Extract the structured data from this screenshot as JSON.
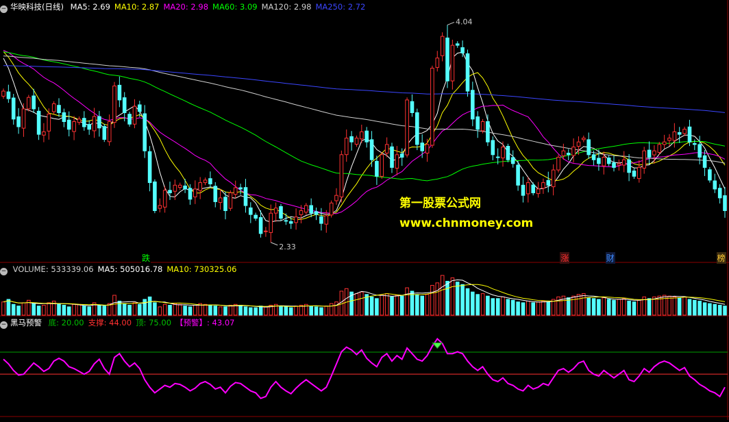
{
  "main_header": {
    "stock_name": "华映科技(日线)",
    "items": [
      {
        "text": "MA5: 2.69",
        "color": "#ffffff"
      },
      {
        "text": "MA10: 2.87",
        "color": "#ffff00"
      },
      {
        "text": "MA20: 2.98",
        "color": "#ff00ff"
      },
      {
        "text": "MA60: 3.09",
        "color": "#00ff00"
      },
      {
        "text": "MA120: 2.98",
        "color": "#d0d0d0"
      },
      {
        "text": "MA250: 2.72",
        "color": "#3b46ff"
      }
    ]
  },
  "volume_header": {
    "items": [
      {
        "text": "VOLUME: 533339.06",
        "color": "#d0d0d0"
      },
      {
        "text": "MA5: 505016.78",
        "color": "#ffffff"
      },
      {
        "text": "MA10: 730325.06",
        "color": "#ffff00"
      }
    ]
  },
  "indicator_header": {
    "name": "黑马预警",
    "items": [
      {
        "text": "底: 20.00",
        "color": "#00c000"
      },
      {
        "text": "支撑: 44.00",
        "color": "#ff3030"
      },
      {
        "text": "顶: 75.00",
        "color": "#00c000"
      },
      {
        "text": "【预警】: 43.07",
        "color": "#ff00ff"
      }
    ]
  },
  "watermark": {
    "line1": "第一股票公式网",
    "line2": "www.chnmoney.com"
  },
  "event_tags": [
    {
      "text": "跌",
      "color": "#00ff00",
      "bg": "#000000",
      "index": 28
    },
    {
      "text": "涨",
      "color": "#ff3030",
      "bg": "#3a1010",
      "index": 111
    },
    {
      "text": "财",
      "color": "#3b8cff",
      "bg": "#101a3a",
      "index": 120
    },
    {
      "text": "榜",
      "color": "#ffcc33",
      "bg": "#3a2a10",
      "index": 142
    }
  ],
  "chart_data": [
    {
      "type": "candlestick",
      "price_max_label": "4.04",
      "price_min_label": "2.33",
      "ylim": [
        2.2,
        4.15
      ],
      "colors": {
        "up": "#ff3232",
        "down": "#54ffff"
      },
      "series_names": [
        "MA5",
        "MA10",
        "MA20",
        "MA60",
        "MA120",
        "MA250"
      ],
      "close": [
        3.52,
        3.46,
        3.3,
        3.24,
        3.38,
        3.47,
        3.38,
        3.18,
        3.2,
        3.34,
        3.42,
        3.35,
        3.28,
        3.22,
        3.28,
        3.3,
        3.24,
        3.22,
        3.32,
        3.23,
        3.14,
        3.28,
        3.56,
        3.45,
        3.35,
        3.26,
        3.4,
        3.36,
        3.05,
        2.8,
        2.58,
        2.62,
        2.74,
        2.72,
        2.78,
        2.78,
        2.75,
        2.67,
        2.75,
        2.8,
        2.82,
        2.79,
        2.65,
        2.68,
        2.58,
        2.72,
        2.76,
        2.75,
        2.62,
        2.55,
        2.52,
        2.4,
        2.42,
        2.56,
        2.6,
        2.52,
        2.5,
        2.48,
        2.53,
        2.58,
        2.62,
        2.56,
        2.55,
        2.48,
        2.54,
        2.64,
        2.7,
        3.02,
        3.15,
        3.12,
        3.15,
        3.2,
        3.12,
        2.98,
        2.85,
        3.02,
        3.1,
        2.92,
        3.02,
        3.0,
        3.45,
        3.35,
        3.1,
        3.05,
        3.1,
        3.7,
        3.78,
        3.95,
        3.6,
        3.88,
        3.88,
        3.82,
        3.52,
        3.3,
        3.22,
        3.28,
        3.12,
        3.02,
        3.0,
        3.08,
        2.98,
        2.95,
        2.78,
        2.7,
        2.8,
        2.72,
        2.75,
        2.8,
        2.78,
        2.9,
        3.0,
        3.05,
        3.02,
        3.08,
        3.12,
        3.15,
        3.02,
        2.98,
        2.95,
        3.0,
        2.95,
        2.92,
        2.95,
        2.98,
        2.88,
        2.85,
        2.92,
        3.05,
        3.0,
        3.05,
        3.1,
        3.12,
        3.15,
        3.2,
        3.18,
        3.22,
        3.12,
        3.1,
        3.0,
        2.92,
        2.82,
        2.75,
        2.68,
        2.58
      ]
    },
    {
      "type": "bar",
      "title": "VOLUME",
      "values": [
        32,
        38,
        26,
        22,
        30,
        36,
        28,
        22,
        24,
        30,
        34,
        28,
        24,
        20,
        26,
        26,
        22,
        20,
        30,
        24,
        22,
        28,
        48,
        34,
        28,
        24,
        30,
        26,
        38,
        44,
        30,
        20,
        26,
        24,
        28,
        26,
        22,
        20,
        24,
        28,
        26,
        24,
        22,
        20,
        20,
        24,
        26,
        24,
        20,
        18,
        18,
        22,
        20,
        24,
        26,
        22,
        20,
        18,
        22,
        24,
        26,
        22,
        20,
        18,
        22,
        28,
        32,
        58,
        64,
        56,
        52,
        56,
        50,
        44,
        40,
        48,
        52,
        44,
        48,
        46,
        66,
        58,
        50,
        46,
        50,
        72,
        78,
        96,
        82,
        90,
        80,
        74,
        64,
        56,
        50,
        52,
        46,
        40,
        40,
        44,
        38,
        36,
        32,
        30,
        34,
        30,
        32,
        34,
        32,
        38,
        44,
        46,
        42,
        46,
        50,
        52,
        42,
        40,
        38,
        42,
        38,
        36,
        38,
        40,
        34,
        32,
        36,
        44,
        40,
        44,
        46,
        48,
        46,
        44,
        42,
        44,
        38,
        36,
        34,
        30,
        28,
        26,
        24,
        22
      ]
    },
    {
      "type": "line",
      "title": "黑马预警",
      "ylim": [
        0,
        100
      ],
      "reference_lines": {
        "bottom": 20,
        "support": 44,
        "top": 75
      },
      "values": [
        60,
        55,
        48,
        43,
        44,
        50,
        56,
        52,
        47,
        50,
        58,
        61,
        58,
        52,
        50,
        47,
        44,
        47,
        55,
        60,
        50,
        44,
        62,
        66,
        58,
        52,
        56,
        50,
        38,
        30,
        24,
        28,
        32,
        30,
        34,
        33,
        30,
        26,
        29,
        34,
        36,
        33,
        28,
        30,
        24,
        31,
        35,
        34,
        30,
        26,
        24,
        18,
        20,
        30,
        36,
        30,
        26,
        23,
        29,
        34,
        38,
        34,
        30,
        26,
        30,
        42,
        55,
        68,
        73,
        70,
        65,
        70,
        61,
        56,
        52,
        62,
        66,
        58,
        64,
        60,
        72,
        66,
        60,
        58,
        64,
        74,
        82,
        77,
        66,
        66,
        68,
        66,
        58,
        52,
        48,
        52,
        44,
        38,
        36,
        40,
        34,
        32,
        28,
        26,
        32,
        28,
        30,
        34,
        32,
        40,
        48,
        50,
        46,
        50,
        56,
        58,
        48,
        44,
        42,
        48,
        44,
        40,
        44,
        48,
        38,
        36,
        42,
        50,
        46,
        52,
        56,
        58,
        56,
        52,
        48,
        51,
        42,
        38,
        33,
        30,
        26,
        24,
        20,
        30
      ]
    }
  ]
}
